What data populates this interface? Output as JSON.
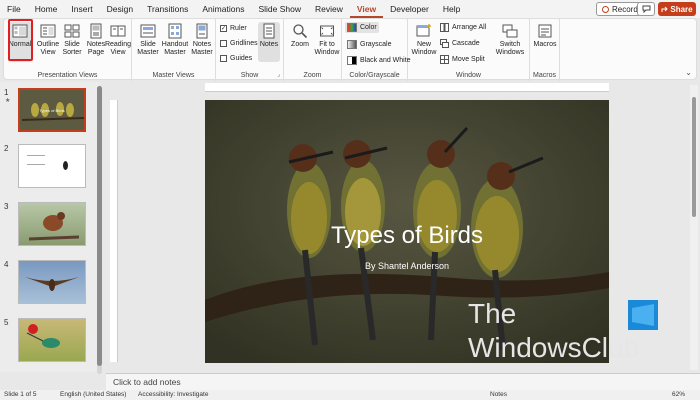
{
  "tabs": [
    "File",
    "Home",
    "Insert",
    "Design",
    "Transitions",
    "Animations",
    "Slide Show",
    "Review",
    "View",
    "Developer",
    "Help"
  ],
  "active_tab": "View",
  "header": {
    "record_label": "Record",
    "share_label": "Share"
  },
  "ribbon": {
    "presentation_views": {
      "label": "Presentation Views",
      "buttons": [
        "Normal",
        "Outline View",
        "Slide Sorter",
        "Notes Page",
        "Reading View"
      ]
    },
    "master_views": {
      "label": "Master Views",
      "buttons": [
        "Slide Master",
        "Handout Master",
        "Notes Master"
      ]
    },
    "show": {
      "label": "Show",
      "ruler": "Ruler",
      "gridlines": "Gridlines",
      "guides": "Guides",
      "notes": "Notes",
      "ruler_checked": true,
      "gridlines_checked": false,
      "guides_checked": false
    },
    "zoom": {
      "label": "Zoom",
      "zoom": "Zoom",
      "fit": "Fit to Window"
    },
    "color": {
      "label": "Color/Grayscale",
      "color": "Color",
      "grayscale": "Grayscale",
      "bw": "Black and White"
    },
    "window": {
      "label": "Window",
      "new_window": "New Window",
      "arrange_all": "Arrange All",
      "cascade": "Cascade",
      "move_split": "Move Split",
      "switch": "Switch Windows"
    },
    "macros": {
      "label": "Macros",
      "macros": "Macros"
    }
  },
  "thumbnails": [
    {
      "num": "1",
      "caption": "Types of Birds"
    },
    {
      "num": "2",
      "caption": ""
    },
    {
      "num": "3",
      "caption": ""
    },
    {
      "num": "4",
      "caption": ""
    },
    {
      "num": "5",
      "caption": ""
    }
  ],
  "slide": {
    "title": "Types of Birds",
    "subtitle": "By Shantel Anderson"
  },
  "notes_placeholder": "Click to add notes",
  "watermark": {
    "line1": "The",
    "line2": "WindowsClub"
  },
  "status": {
    "slide_of": "Slide 1 of 5",
    "language": "English (United States)",
    "accessibility": "Accessibility: Investigate",
    "notes": "Notes",
    "zoom": "62%"
  },
  "colors": {
    "accent": "#b7472a",
    "share": "#c43e1c",
    "highlight": "#e02020"
  }
}
